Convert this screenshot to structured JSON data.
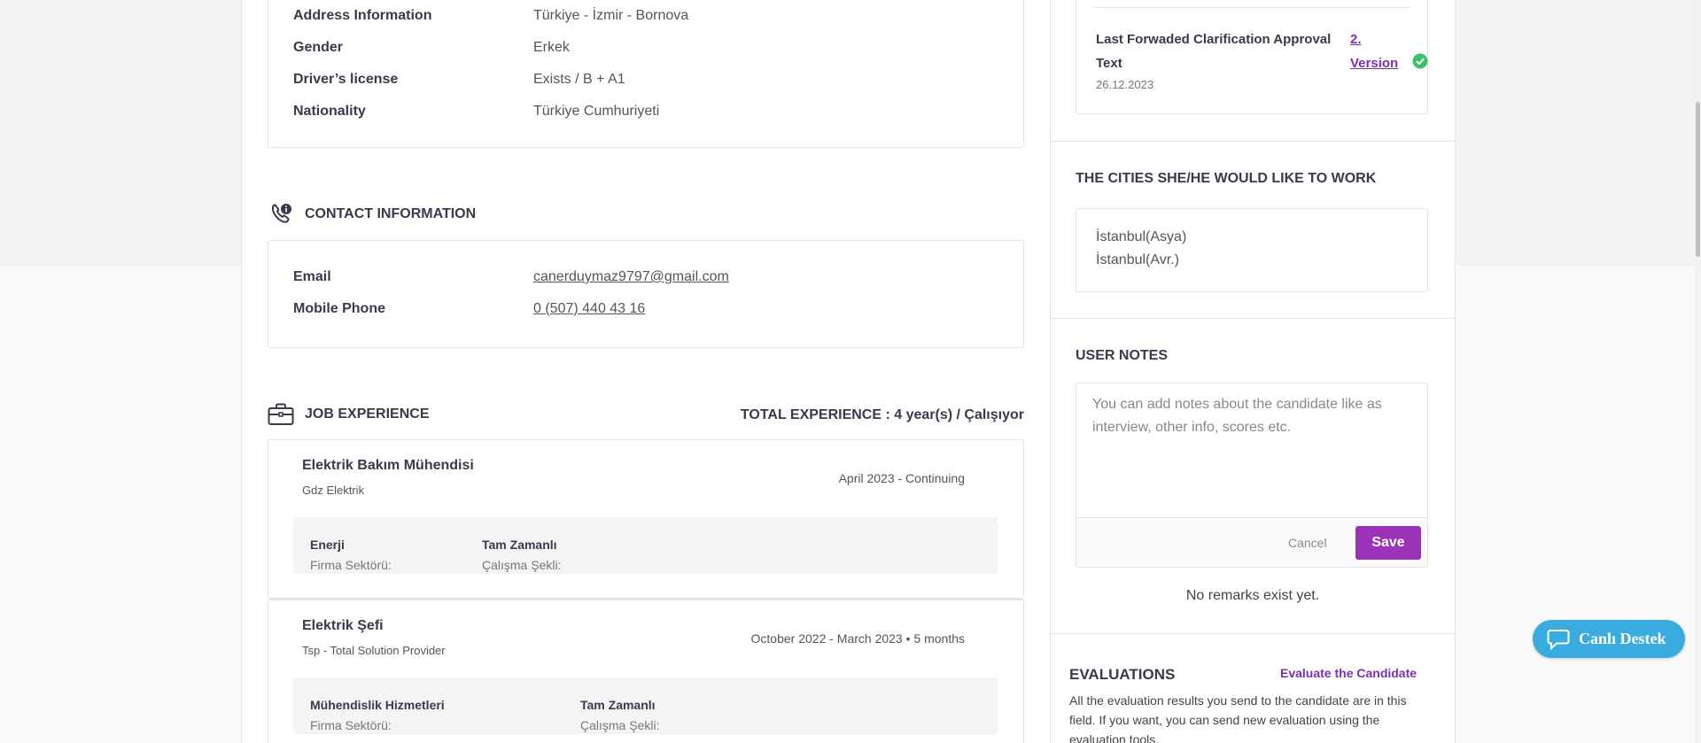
{
  "personal": {
    "rows": [
      {
        "label": "Address Information",
        "value": "Türkiye - İzmir - Bornova"
      },
      {
        "label": "Gender",
        "value": "Erkek"
      },
      {
        "label": "Driver’s license",
        "value": "Exists / B + A1"
      },
      {
        "label": "Nationality",
        "value": "Türkiye Cumhuriyeti"
      }
    ]
  },
  "contact": {
    "title": "CONTACT INFORMATION",
    "icon": "phone-info-icon",
    "email_label": "Email",
    "email_value": "canerduymaz9797@gmail.com",
    "phone_label": "Mobile Phone",
    "phone_value": "0 (507) 440 43 16"
  },
  "experience": {
    "title": "JOB EXPERIENCE",
    "icon": "briefcase-icon",
    "total": "TOTAL EXPERIENCE : 4 year(s) / Çalışıyor",
    "jobs": [
      {
        "title": "Elektrik Bakım Mühendisi",
        "company": "Gdz Elektrik",
        "date": "April 2023 - Continuing",
        "sector_label": "Firma Sektörü:",
        "sector_value": "Enerji",
        "work_label": "Çalışma Şekli:",
        "work_value": "Tam Zamanlı"
      },
      {
        "title": "Elektrik Şefi",
        "company": "Tsp - Total Solution Provider",
        "date": "October 2022 - March 2023 •   5 months",
        "sector_label": "Firma Sektörü:",
        "sector_value": "Mühendislik Hizmetleri",
        "work_label": "Çalışma Şekli:",
        "work_value": "Tam Zamanlı"
      }
    ]
  },
  "approval": {
    "label": "Last Forwaded Clarification Approval Text",
    "date": "26.12.2023",
    "version_link": "2. Version",
    "status_icon": "check-circle-icon",
    "status_color": "#3cc26b"
  },
  "cities": {
    "title": "THE CITIES SHE/HE WOULD LIKE TO WORK",
    "items": [
      "İstanbul(Asya)",
      "İstanbul(Avr.)"
    ]
  },
  "notes": {
    "title": "USER NOTES",
    "placeholder": "You can add notes about the candidate like as interview, other info, scores etc.",
    "cancel_label": "Cancel",
    "save_label": "Save",
    "empty_text": "No remarks exist yet."
  },
  "evaluations": {
    "title": "EVALUATIONS",
    "link": "Evaluate the Candidate",
    "description": "All the evaluation results you send to the candidate are in this field. If you want, you can send new evaluation using the evaluation tools."
  },
  "live_support": {
    "label": "Canlı Destek",
    "icon": "chat-bubble-icon"
  },
  "colors": {
    "accent": "#9b33b8",
    "link": "#7b2fb3",
    "support": "#3aabde"
  }
}
